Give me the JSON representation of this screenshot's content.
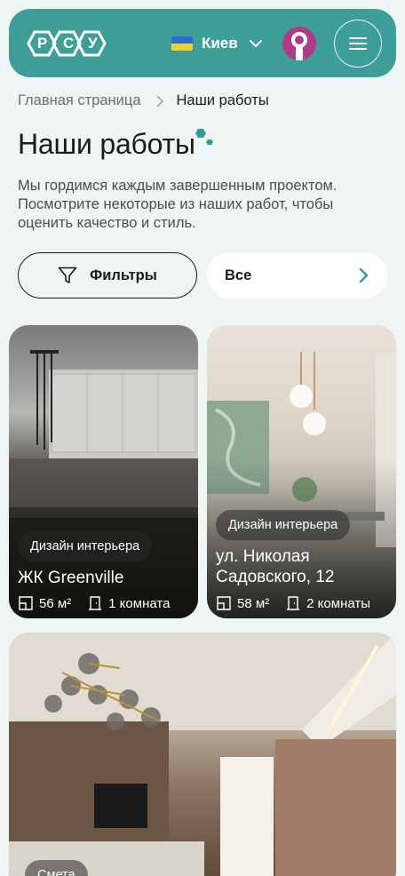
{
  "header": {
    "logo_letters": [
      "Р",
      "С",
      "У"
    ],
    "city": "Киев",
    "colors": {
      "header_bg": "#3e9e98",
      "flag_blue": "#2f6cd3",
      "flag_yellow": "#f5cf2a",
      "avatar": "#b03a8c"
    }
  },
  "breadcrumb": {
    "home": "Главная страница",
    "current": "Наши работы"
  },
  "page": {
    "title": "Наши работы",
    "description": "Мы гордимся каждым завершенным проектом. Посмотрите некоторые из наших работ, чтобы оценить качество и стиль."
  },
  "filters": {
    "filter_label": "Фильтры",
    "select_value": "Все"
  },
  "cards": [
    {
      "badge": "Дизайн интерьера",
      "title": "ЖК Greenville",
      "area": "56 м²",
      "rooms": "1 комната"
    },
    {
      "badge": "Дизайн интерьера",
      "title": "ул. Николая Садовского, 12",
      "area": "58 м²",
      "rooms": "2 комнаты"
    },
    {
      "badge": "Смета"
    }
  ],
  "icons": [
    "filter-icon",
    "chevron-down-icon",
    "chevron-right-icon",
    "menu-icon",
    "area-icon",
    "door-icon"
  ]
}
